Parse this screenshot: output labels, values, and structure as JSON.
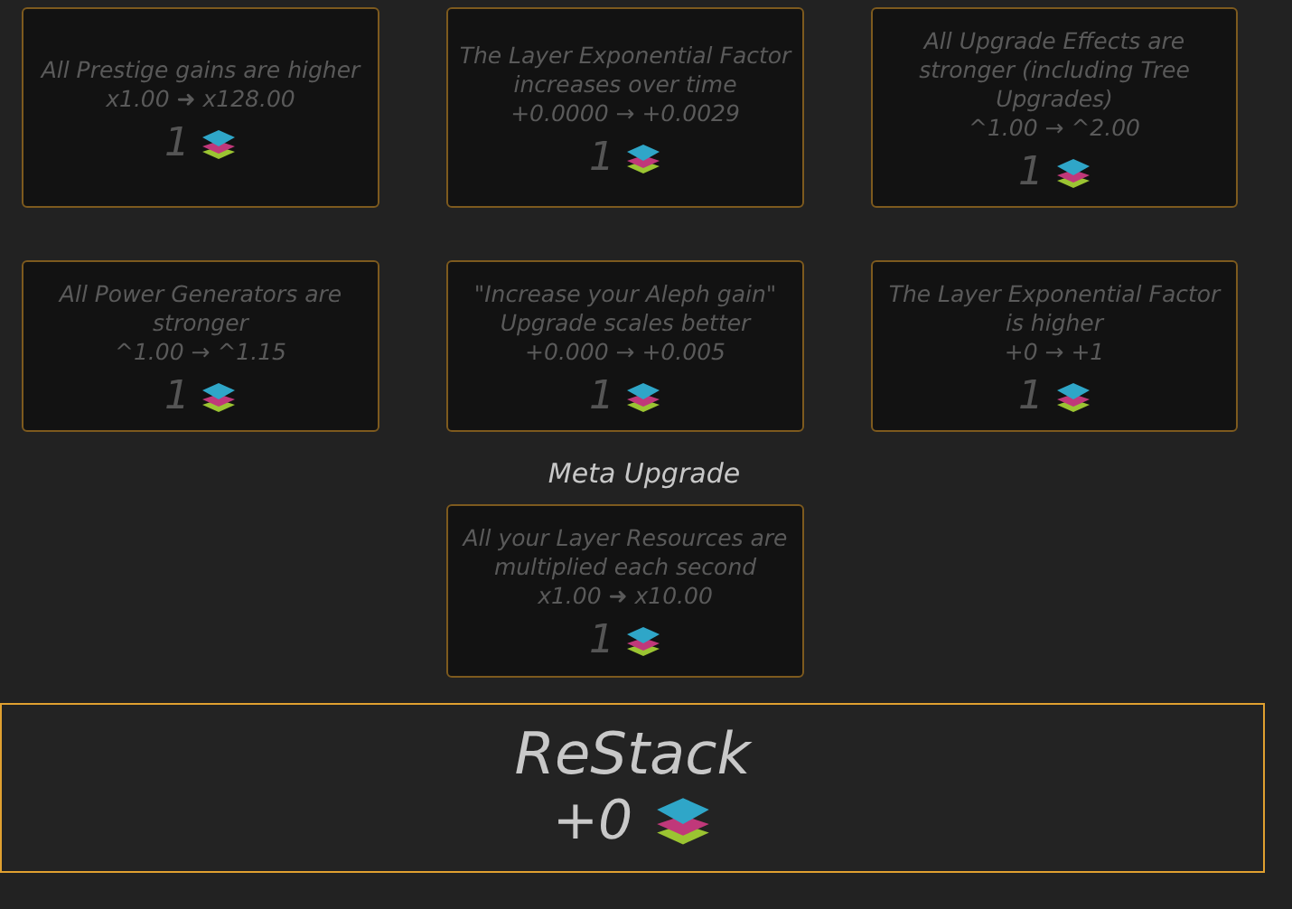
{
  "upgrades": [
    {
      "description": "All Prestige gains are higher",
      "effect": "x1.00 ➜ x128.00",
      "cost": "1"
    },
    {
      "description": "The Layer Exponential Factor increases over time",
      "effect": "+0.0000 → +0.0029",
      "cost": "1"
    },
    {
      "description": "All Upgrade Effects are stronger (including Tree Upgrades)",
      "effect": "^1.00 → ^2.00",
      "cost": "1"
    },
    {
      "description": "All Power Generators are stronger",
      "effect": "^1.00 → ^1.15",
      "cost": "1"
    },
    {
      "description": "\"Increase your Aleph gain\" Upgrade scales better",
      "effect": "+0.000 → +0.005",
      "cost": "1"
    },
    {
      "description": "The Layer Exponential Factor is higher",
      "effect": "+0 → +1",
      "cost": "1"
    }
  ],
  "meta_title": "Meta Upgrade",
  "meta_upgrade": {
    "description": "All your Layer Resources are multiplied each second",
    "effect": "x1.00 ➜ x10.00",
    "cost": "1"
  },
  "restack": {
    "title": "ReStack",
    "gain": "+0"
  }
}
